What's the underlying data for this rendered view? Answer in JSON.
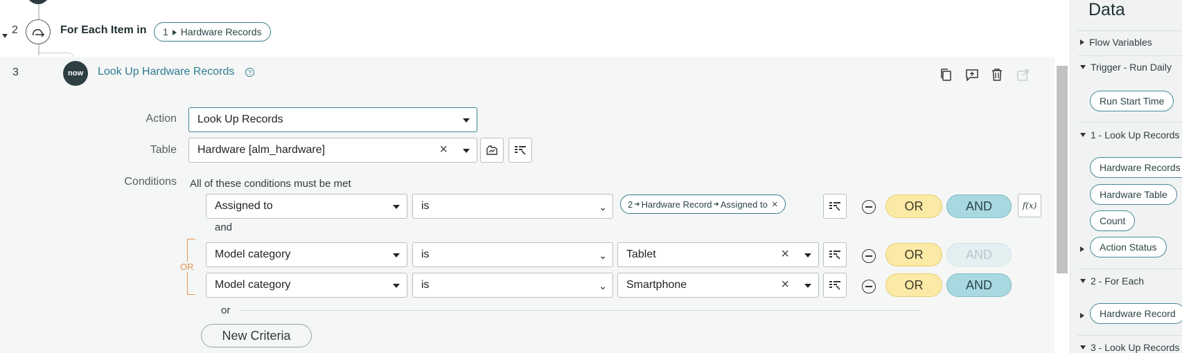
{
  "flow": {
    "step2": {
      "number": "2",
      "title": "For Each Item in",
      "pill_prefix": "1",
      "pill_label": "Hardware Records"
    },
    "step3": {
      "number": "3",
      "logo_text": "now",
      "title": "Look Up Hardware Records",
      "help_icon": "help-circle-icon",
      "toolbar_icons": [
        "duplicate-icon",
        "add-comment-icon",
        "delete-icon",
        "open-external-icon"
      ]
    }
  },
  "form": {
    "action_label": "Action",
    "action_value": "Look Up Records",
    "table_label": "Table",
    "table_value": "Hardware [alm_hardware]",
    "conditions_label": "Conditions",
    "conditions_note": "All of these conditions must be met",
    "and_text": "and",
    "or_group_text": "OR",
    "or_divider_text": "or",
    "new_criteria_label": "New Criteria",
    "function_label": "f(x)",
    "rows": [
      {
        "field": "Assigned to",
        "operator": "is",
        "pill_part1": "2",
        "pill_part2": "Hardware Record",
        "pill_part3": "Assigned to",
        "or_label": "OR",
        "and_label": "AND"
      },
      {
        "field": "Model category",
        "operator": "is",
        "value": "Tablet",
        "or_label": "OR",
        "and_label": "AND"
      },
      {
        "field": "Model category",
        "operator": "is",
        "value": "Smartphone",
        "or_label": "OR",
        "and_label": "AND"
      }
    ]
  },
  "data_panel": {
    "title": "Data",
    "flow_variables": "Flow Variables",
    "trigger_section": "Trigger - Run Daily",
    "trigger_items": [
      "Run Start Time"
    ],
    "lookup1_section": "1 - Look Up Records",
    "lookup1_items": [
      "Hardware Records",
      "Hardware Table",
      "Count",
      "Action Status"
    ],
    "foreach_section": "2 - For Each",
    "foreach_items": [
      "Hardware Record"
    ],
    "lookup3_section": "3 - Look Up Records"
  },
  "colors": {
    "accent": "#3b7c8d",
    "or_fill": "#fbe9a6",
    "and_fill": "#a9d9e0",
    "or_group": "#e39450"
  }
}
